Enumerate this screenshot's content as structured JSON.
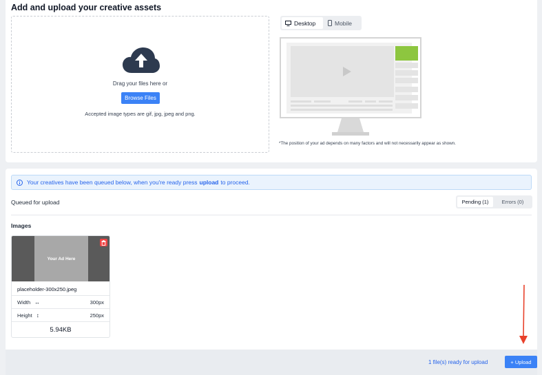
{
  "upload_section": {
    "title": "Add and upload your creative assets",
    "drag_text": "Drag your files here or",
    "browse_label": "Browse Files",
    "accepted_text": "Accepted image types are gif, jpg, jpeg and png."
  },
  "preview": {
    "tabs": [
      {
        "label": "Desktop",
        "icon": "monitor-icon",
        "active": true
      },
      {
        "label": "Mobile",
        "icon": "phone-icon",
        "active": false
      }
    ],
    "footnote": "*The position of your ad depends on many factors and will not necessarily appear as shown."
  },
  "queue": {
    "banner_prefix": "Your creatives have been queued below, when you're ready press",
    "banner_action": "upload",
    "banner_suffix": "to proceed.",
    "queued_label": "Queued for upload",
    "tabs": [
      {
        "label": "Pending (1)",
        "active": true
      },
      {
        "label": "Errors (0)",
        "active": false
      }
    ],
    "images_label": "Images"
  },
  "asset": {
    "thumbnail_text": "Your Ad Here",
    "filename": "placeholder-300x250.jpeg",
    "width_label": "Width",
    "width_value": "300px",
    "height_label": "Height",
    "height_value": "250px",
    "size": "5.94KB"
  },
  "footer": {
    "ready_text": "1 file(s) ready for upload",
    "upload_label": "+ Upload"
  },
  "colors": {
    "primary": "#3b82f6",
    "banner_bg": "#eaf3fd",
    "ad_slot_green": "#8dc63f",
    "delete_red": "#ef4444",
    "annotation_arrow": "#e8412b"
  }
}
